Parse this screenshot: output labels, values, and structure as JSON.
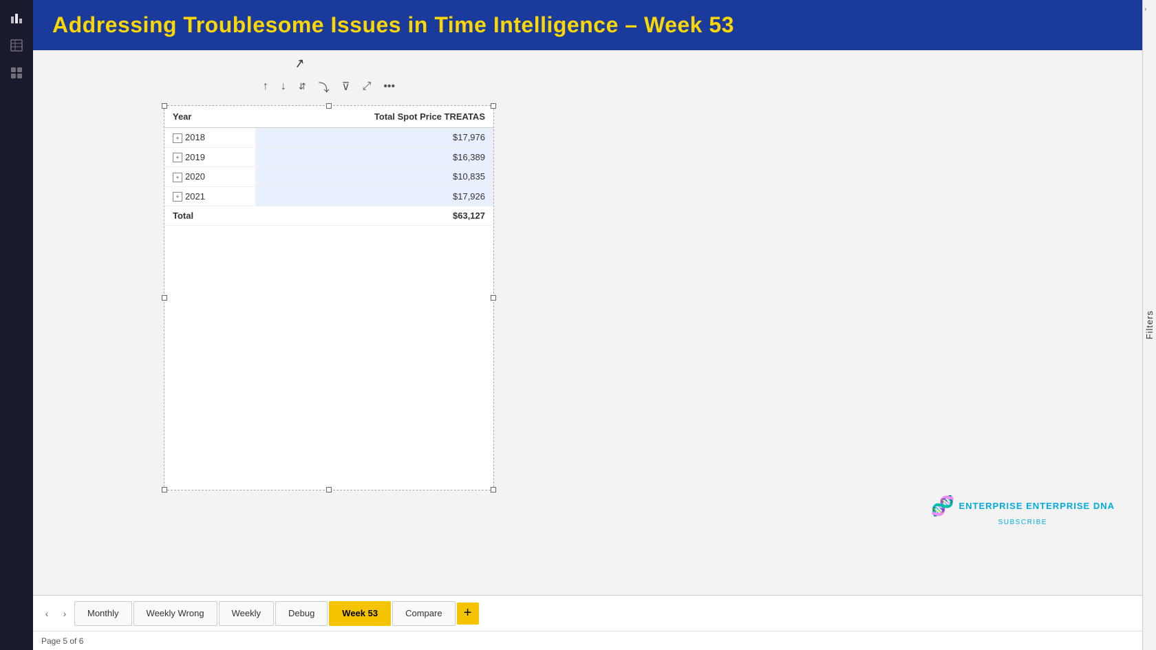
{
  "header": {
    "title": "Addressing Troublesome Issues in Time Intelligence – Week 53"
  },
  "sidebar": {
    "icons": [
      {
        "name": "bar-chart-icon",
        "glyph": "📊"
      },
      {
        "name": "table-icon",
        "glyph": "⊞"
      },
      {
        "name": "layers-icon",
        "glyph": "⊟"
      }
    ]
  },
  "visual": {
    "toolbar": {
      "sort_asc": "↑",
      "sort_desc": "↓",
      "sort_both": "⇅",
      "sort_expand": "⤵",
      "filter": "⊽",
      "expand_icon": "⤢",
      "more": "…"
    },
    "table": {
      "col1_header": "Year",
      "col2_header": "Total Spot Price TREATAS",
      "rows": [
        {
          "year": "2018",
          "value": "$17,976"
        },
        {
          "year": "2019",
          "value": "$16,389"
        },
        {
          "year": "2020",
          "value": "$10,835"
        },
        {
          "year": "2021",
          "value": "$17,926"
        }
      ],
      "total_label": "Total",
      "total_value": "$63,127"
    }
  },
  "tabs": [
    {
      "label": "Monthly",
      "active": false
    },
    {
      "label": "Weekly Wrong",
      "active": false
    },
    {
      "label": "Weekly",
      "active": false
    },
    {
      "label": "Debug",
      "active": false
    },
    {
      "label": "Week 53",
      "active": true
    },
    {
      "label": "Compare",
      "active": false
    }
  ],
  "status": {
    "page_info": "Page 5 of 6"
  },
  "right_panel": {
    "label": "Filters"
  },
  "logo": {
    "company": "ENTERPRISE DNA",
    "subscribe": "SUBSCRIBE"
  }
}
